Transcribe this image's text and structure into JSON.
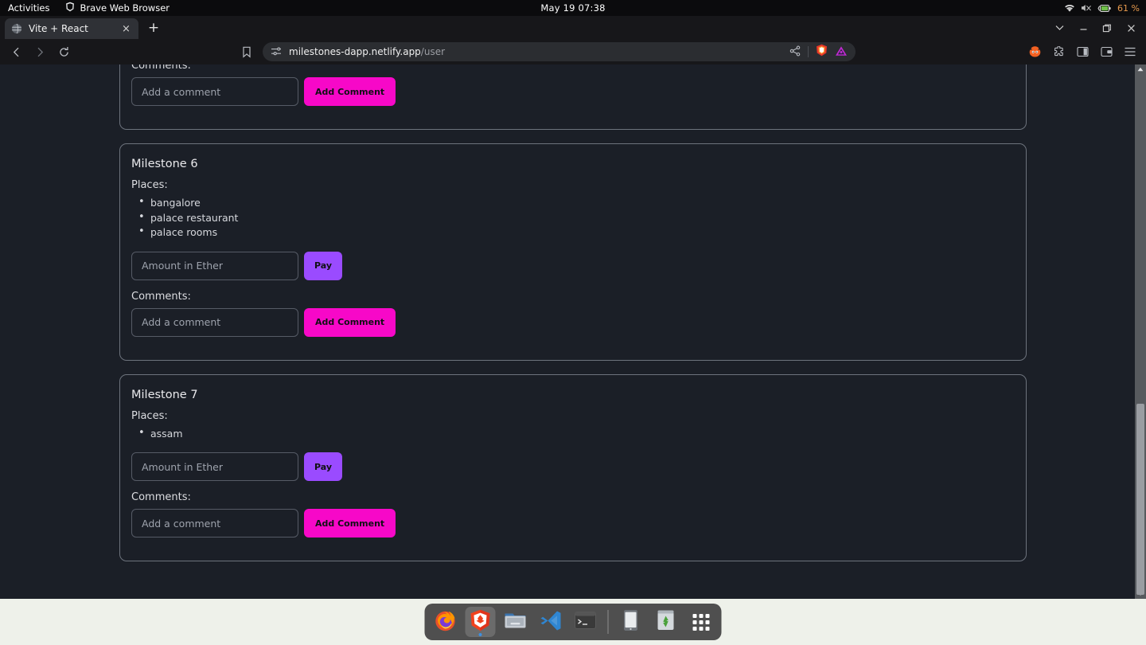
{
  "os_topbar": {
    "activities": "Activities",
    "app_name": "Brave Web Browser",
    "clock": "May 19  07:38",
    "battery": "61 %",
    "icons": [
      "wifi-icon",
      "volume-muted-icon",
      "battery-charging-icon"
    ]
  },
  "browser": {
    "tab": {
      "title": "Vite + React",
      "favicon": "globe-icon",
      "close": "×"
    },
    "new_tab": "+",
    "window_controls": {
      "chevron": "⌄",
      "minimize": "—",
      "maximize": "❐",
      "close": "✕"
    },
    "nav": {
      "back": "back-arrow-icon",
      "forward": "forward-arrow-icon",
      "reload": "reload-icon",
      "bookmark": "bookmark-icon"
    },
    "url": {
      "host": "milestones-dapp.netlify.app",
      "path": "/user",
      "permission_icon": "site-settings-icon",
      "share_icon": "share-icon",
      "shield_icon": "brave-shield-icon",
      "extension_icon": "purple-triangle-icon"
    },
    "toolbar_right_icons": [
      "firefox-relay-icon",
      "extensions-puzzle-icon",
      "sidebar-panel-icon",
      "wallet-icon",
      "hamburger-menu-icon"
    ]
  },
  "page": {
    "labels": {
      "places": "Places:",
      "comments": "Comments:"
    },
    "amount_placeholder": "Amount in Ether",
    "comment_placeholder": "Add a comment",
    "pay_label": "Pay",
    "add_comment_label": "Add Comment",
    "colors": {
      "background": "#1b1f27",
      "card_border": "#6d737d",
      "pay_button": "#9a4bff",
      "comment_button": "#f708c8",
      "text": "#e9e9ec"
    },
    "milestones": [
      {
        "title": "",
        "places": []
      },
      {
        "title": "Milestone 6",
        "places": [
          "bangalore",
          "palace restaurant",
          "palace rooms"
        ]
      },
      {
        "title": "Milestone 7",
        "places": [
          "assam"
        ]
      }
    ]
  },
  "dock": {
    "items": [
      {
        "name": "firefox",
        "active": false
      },
      {
        "name": "brave",
        "active": true
      },
      {
        "name": "files",
        "active": false
      },
      {
        "name": "vscode",
        "active": false
      },
      {
        "name": "terminal",
        "active": false
      },
      {
        "name": "separator",
        "active": false
      },
      {
        "name": "device",
        "active": false
      },
      {
        "name": "trash",
        "active": false
      },
      {
        "name": "show-apps",
        "active": false
      }
    ]
  }
}
